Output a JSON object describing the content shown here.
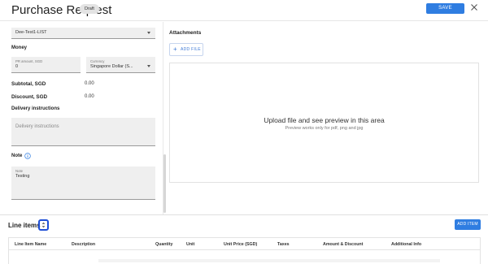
{
  "header": {
    "title": "Purchase Request",
    "status_badge": "Draft",
    "save_label": "SAVE"
  },
  "form": {
    "list_select": {
      "value": "Dee-Test1-LIST"
    },
    "money": {
      "section_label": "Money",
      "pr_amount": {
        "label": "PR amount, SGD",
        "value": "0"
      },
      "currency": {
        "label": "Currency",
        "value": "Singapore Dollar (S..."
      }
    },
    "subtotal": {
      "label": "Subtotal, SGD",
      "value": "0.00"
    },
    "discount": {
      "label": "Discount, SGD",
      "value": "0.00"
    },
    "delivery": {
      "section_label": "Delivery instructions",
      "placeholder": "Delivery instructions"
    },
    "note": {
      "section_label": "Note",
      "field_label": "Note",
      "value": "Testing"
    }
  },
  "attachments": {
    "title": "Attachments",
    "add_file_label": "ADD FILE",
    "drop_title": "Upload file and see preview in this area",
    "drop_subtitle": "Preview works only for pdf, png and jpg"
  },
  "line_items": {
    "title": "Line items",
    "add_item_label": "ADD ITEM",
    "columns": [
      "Line Item Name",
      "Description",
      "Quantity",
      "Unit",
      "Unit Price (SGD)",
      "Taxes",
      "Amount & Discount",
      "Additional Info"
    ]
  },
  "colors": {
    "primary": "#2f7de1",
    "focus_ring": "#1f4fd6",
    "field_bg": "#efefef"
  },
  "icons": {
    "close": "close-icon",
    "dropdown": "chevron-down-icon",
    "info": "info-icon",
    "plus": "plus-icon",
    "sort": "sort-icon"
  }
}
